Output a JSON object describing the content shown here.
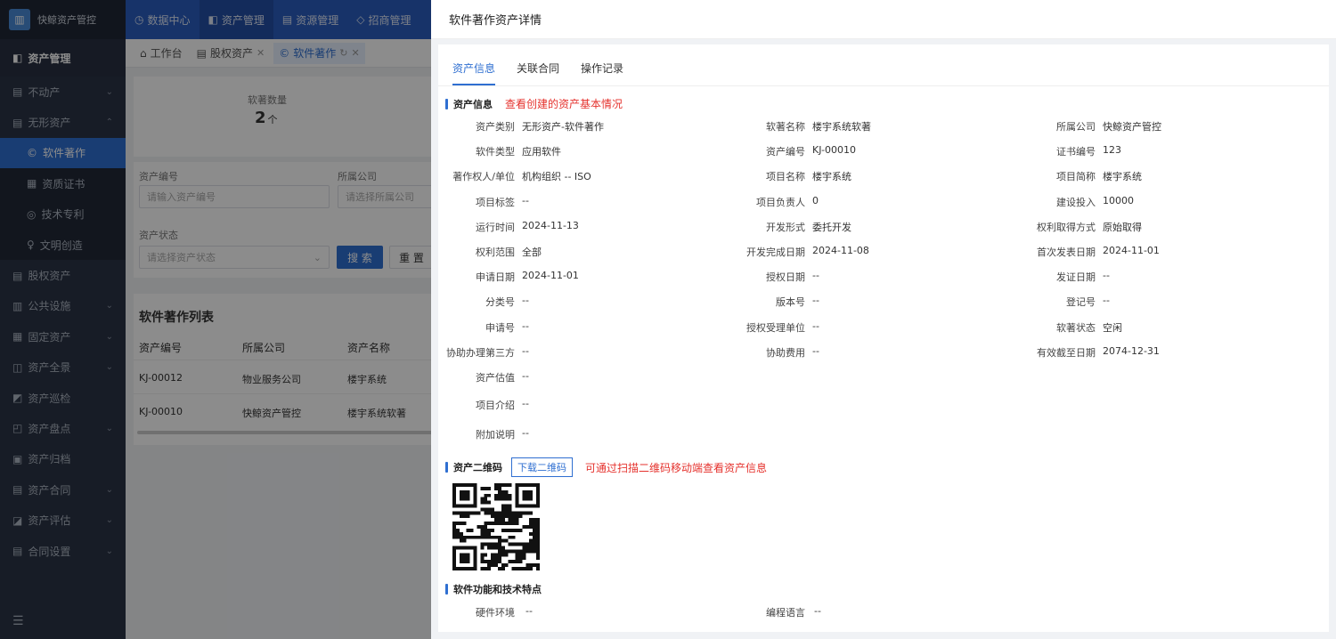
{
  "app": {
    "name": "快鲸资产管控"
  },
  "topnav": [
    {
      "label": "数据中心",
      "icon": "clock-icon"
    },
    {
      "label": "资产管理",
      "icon": "cube-icon"
    },
    {
      "label": "资源管理",
      "icon": "building-icon"
    },
    {
      "label": "招商管理",
      "icon": "tag-icon"
    }
  ],
  "sidebar": {
    "header": "资产管理",
    "items": [
      {
        "label": "不动产",
        "arrow": "⌄"
      },
      {
        "label": "无形资产",
        "arrow": "⌃"
      },
      {
        "label": "软件著作",
        "sub": true,
        "active": true
      },
      {
        "label": "资质证书",
        "sub": true
      },
      {
        "label": "技术专利",
        "sub": true
      },
      {
        "label": "文明创造",
        "sub": true
      },
      {
        "label": "股权资产"
      },
      {
        "label": "公共设施",
        "arrow": "⌄"
      },
      {
        "label": "固定资产",
        "arrow": "⌄"
      },
      {
        "label": "资产全景",
        "arrow": "⌄"
      },
      {
        "label": "资产巡检"
      },
      {
        "label": "资产盘点",
        "arrow": "⌄"
      },
      {
        "label": "资产归档"
      },
      {
        "label": "资产合同",
        "arrow": "⌄"
      },
      {
        "label": "资产评估",
        "arrow": "⌄"
      },
      {
        "label": "合同设置",
        "arrow": "⌄"
      }
    ]
  },
  "tabs": {
    "t1": "工作台",
    "t2": "股权资产",
    "t3": "软件著作"
  },
  "bg": {
    "stat_label": "软著数量",
    "stat_value": "2",
    "stat_unit": "个",
    "f_code": "资产编号",
    "f_code_ph": "请输入资产编号",
    "f_company": "所属公司",
    "f_company_ph": "请选择所属公司",
    "f_status": "资产状态",
    "f_status_ph": "请选择资产状态",
    "btn_search": "搜 索",
    "btn_reset": "重 置",
    "list_title": "软件著作列表",
    "cols": [
      "资产编号",
      "所属公司",
      "资产名称"
    ],
    "rows": [
      [
        "KJ-00012",
        "物业服务公司",
        "楼宇系统"
      ],
      [
        "KJ-00010",
        "快鲸资产管控",
        "楼宇系统软著"
      ]
    ]
  },
  "drawer": {
    "title": "软件著作资产详情",
    "tabs": [
      "资产信息",
      "关联合同",
      "操作记录"
    ],
    "sec1": "资产信息",
    "sec1_hint": "查看创建的资产基本情况",
    "rows": [
      [
        [
          "资产类别",
          "无形资产-软件著作"
        ],
        [
          "软著名称",
          "楼宇系统软著"
        ],
        [
          "所属公司",
          "快鲸资产管控"
        ]
      ],
      [
        [
          "软件类型",
          "应用软件"
        ],
        [
          "资产编号",
          "KJ-00010"
        ],
        [
          "证书编号",
          "123"
        ]
      ],
      [
        [
          "著作权人/单位",
          "机构组织 -- ISO"
        ],
        [
          "项目名称",
          "楼宇系统"
        ],
        [
          "项目简称",
          "楼宇系统"
        ]
      ],
      [
        [
          "项目标签",
          "--"
        ],
        [
          "项目负责人",
          "0"
        ],
        [
          "建设投入",
          "10000"
        ]
      ],
      [
        [
          "运行时间",
          "2024-11-13"
        ],
        [
          "开发形式",
          "委托开发"
        ],
        [
          "权利取得方式",
          "原始取得"
        ]
      ],
      [
        [
          "权利范围",
          "全部"
        ],
        [
          "开发完成日期",
          "2024-11-08"
        ],
        [
          "首次发表日期",
          "2024-11-01"
        ]
      ],
      [
        [
          "申请日期",
          "2024-11-01"
        ],
        [
          "授权日期",
          "--"
        ],
        [
          "发证日期",
          "--"
        ]
      ],
      [
        [
          "分类号",
          "--"
        ],
        [
          "版本号",
          "--"
        ],
        [
          "登记号",
          "--"
        ]
      ],
      [
        [
          "申请号",
          "--"
        ],
        [
          "授权受理单位",
          "--"
        ],
        [
          "软著状态",
          "空闲"
        ]
      ],
      [
        [
          "协助办理第三方",
          "--"
        ],
        [
          "协助费用",
          "--"
        ],
        [
          "有效截至日期",
          "2074-12-31"
        ]
      ]
    ],
    "single": [
      [
        "资产估值",
        "--"
      ],
      [
        "项目介绍",
        "--"
      ],
      [
        "附加说明",
        "--"
      ]
    ],
    "sec2": "资产二维码",
    "sec2_btn": "下载二维码",
    "sec2_hint": "可通过扫描二维码移动端查看资产信息",
    "sec3": "软件功能和技术特点",
    "sec3_rows": [
      [
        "硬件环境",
        "--"
      ],
      [
        "编程语言",
        "--"
      ]
    ]
  }
}
